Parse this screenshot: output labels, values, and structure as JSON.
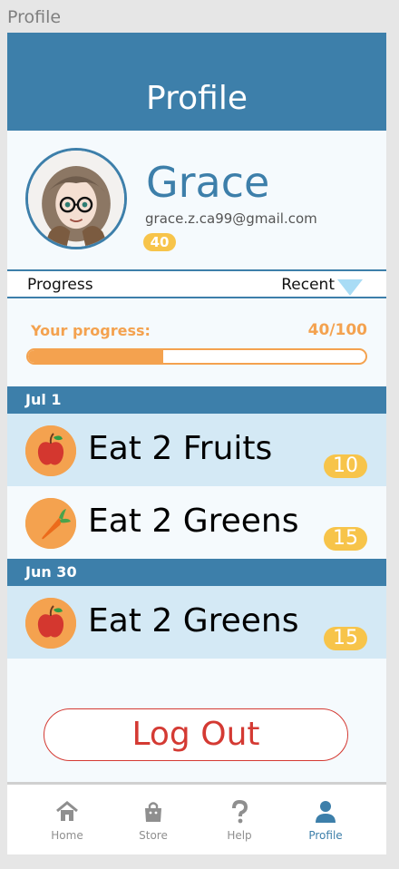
{
  "window": {
    "title": "Profile"
  },
  "header": {
    "title": "Profile"
  },
  "user": {
    "name": "Grace",
    "email": "grace.z.ca99@gmail.com",
    "points": "40"
  },
  "tabs": {
    "progress_label": "Progress",
    "sort_label": "Recent"
  },
  "progress": {
    "label": "Your progress:",
    "current": 40,
    "total": 100,
    "text": "40/100"
  },
  "history": [
    {
      "date": "Jul 1",
      "entries": [
        {
          "icon": "apple-icon",
          "text": "Eat 2 Fruits",
          "points": "10"
        },
        {
          "icon": "carrot-icon",
          "text": "Eat 2 Greens",
          "points": "15"
        }
      ]
    },
    {
      "date": "Jun 30",
      "entries": [
        {
          "icon": "apple-icon",
          "text": "Eat 2 Greens",
          "points": "15"
        }
      ]
    }
  ],
  "logout_label": "Log Out",
  "nav": {
    "items": [
      {
        "label": "Home",
        "icon": "home-icon"
      },
      {
        "label": "Store",
        "icon": "shopping-bag-icon"
      },
      {
        "label": "Help",
        "icon": "question-icon"
      },
      {
        "label": "Profile",
        "icon": "user-icon",
        "active": true
      }
    ]
  },
  "colors": {
    "primary": "#3d7faa",
    "accent": "#f4a24f",
    "badge": "#f7c44a",
    "danger": "#d43a33"
  }
}
